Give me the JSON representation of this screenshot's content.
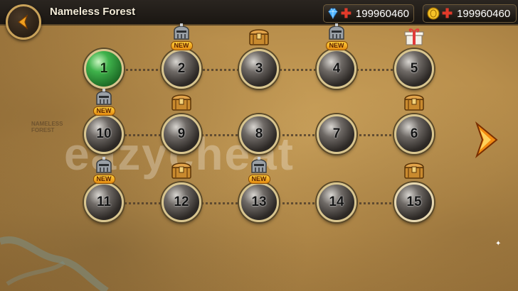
{
  "header": {
    "title": "Nameless Forest",
    "gems": "199960460",
    "gold": "199960460"
  },
  "map_label": "NAMELESS\nFOREST",
  "watermark": "eazycheat",
  "stages": [
    {
      "n": "1",
      "badge": "",
      "new": false,
      "state": "current"
    },
    {
      "n": "2",
      "badge": "helmet-icon",
      "new": true
    },
    {
      "n": "3",
      "badge": "chest-icon",
      "new": false
    },
    {
      "n": "4",
      "badge": "helmet-icon",
      "new": true
    },
    {
      "n": "5",
      "badge": "gift-icon",
      "new": false
    },
    {
      "n": "10",
      "badge": "helmet-icon",
      "new": true
    },
    {
      "n": "9",
      "badge": "chest-icon",
      "new": false
    },
    {
      "n": "8",
      "badge": "",
      "new": false
    },
    {
      "n": "7",
      "badge": "",
      "new": false
    },
    {
      "n": "6",
      "badge": "chest-icon",
      "new": false
    },
    {
      "n": "11",
      "badge": "helmet-icon",
      "new": true
    },
    {
      "n": "12",
      "badge": "chest-icon",
      "new": false
    },
    {
      "n": "13",
      "badge": "helmet-icon",
      "new": true
    },
    {
      "n": "14",
      "badge": "",
      "new": false
    },
    {
      "n": "15",
      "badge": "chest-icon",
      "new": false,
      "state": "boss"
    }
  ],
  "new_label": "NEW",
  "colors": {
    "gold_trim": "#d8c58f",
    "accent_orange": "#f0a020",
    "bar": "#1a1612"
  }
}
